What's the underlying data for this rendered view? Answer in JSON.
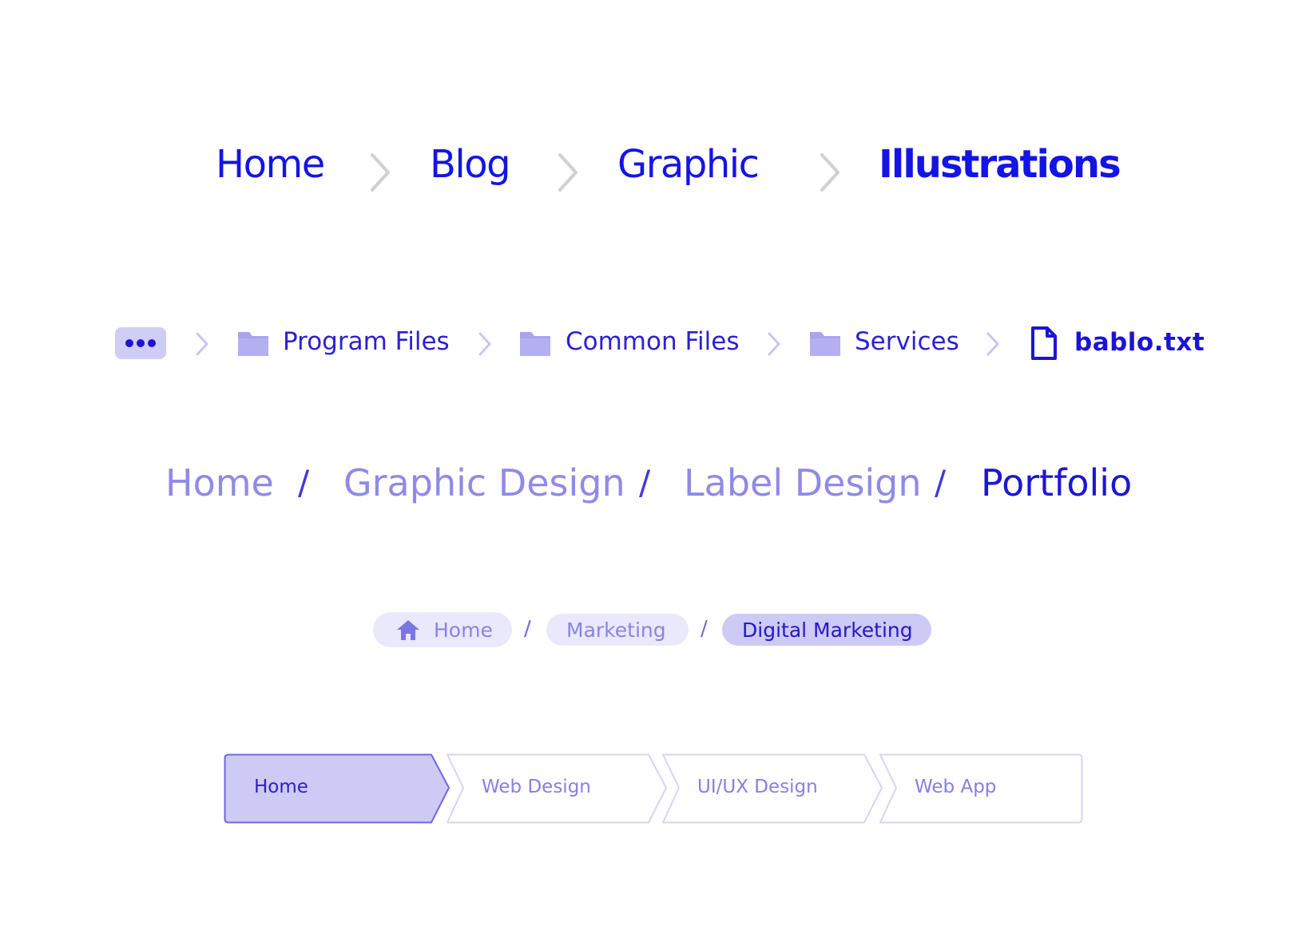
{
  "breadcrumb_chevron": {
    "items": [
      {
        "label": "Home"
      },
      {
        "label": "Blog"
      },
      {
        "label": "Graphic"
      },
      {
        "label": "Illustrations",
        "current": true
      }
    ],
    "separator_icon": "chevron-right-icon"
  },
  "breadcrumb_files": {
    "overflow_icon": "ellipsis-icon",
    "items": [
      {
        "label": "Program Files",
        "icon": "folder-icon"
      },
      {
        "label": "Common Files",
        "icon": "folder-icon"
      },
      {
        "label": "Services",
        "icon": "folder-icon"
      },
      {
        "label": "bablo.txt",
        "icon": "file-icon",
        "current": true
      }
    ],
    "separator_icon": "chevron-right-icon"
  },
  "breadcrumb_slash": {
    "separator": "/",
    "items": [
      {
        "label": "Home"
      },
      {
        "label": "Graphic Design"
      },
      {
        "label": "Label Design"
      },
      {
        "label": "Portfolio",
        "current": true
      }
    ]
  },
  "breadcrumb_pills": {
    "separator": "/",
    "items": [
      {
        "label": "Home",
        "icon": "home-icon"
      },
      {
        "label": "Marketing"
      },
      {
        "label": "Digital Marketing",
        "current": true
      }
    ]
  },
  "breadcrumb_steps": {
    "items": [
      {
        "label": "Home",
        "current": true
      },
      {
        "label": "Web Design"
      },
      {
        "label": "UI/UX Design"
      },
      {
        "label": "Web App"
      }
    ]
  },
  "colors": {
    "primary": "#1414e6",
    "muted": "#8f8ae8",
    "light_fill": "#cdcaf5",
    "pale_fill": "#eae9fb",
    "chevron_gray": "#cfcfd6",
    "chevron_lavender": "#c9c6f2"
  }
}
